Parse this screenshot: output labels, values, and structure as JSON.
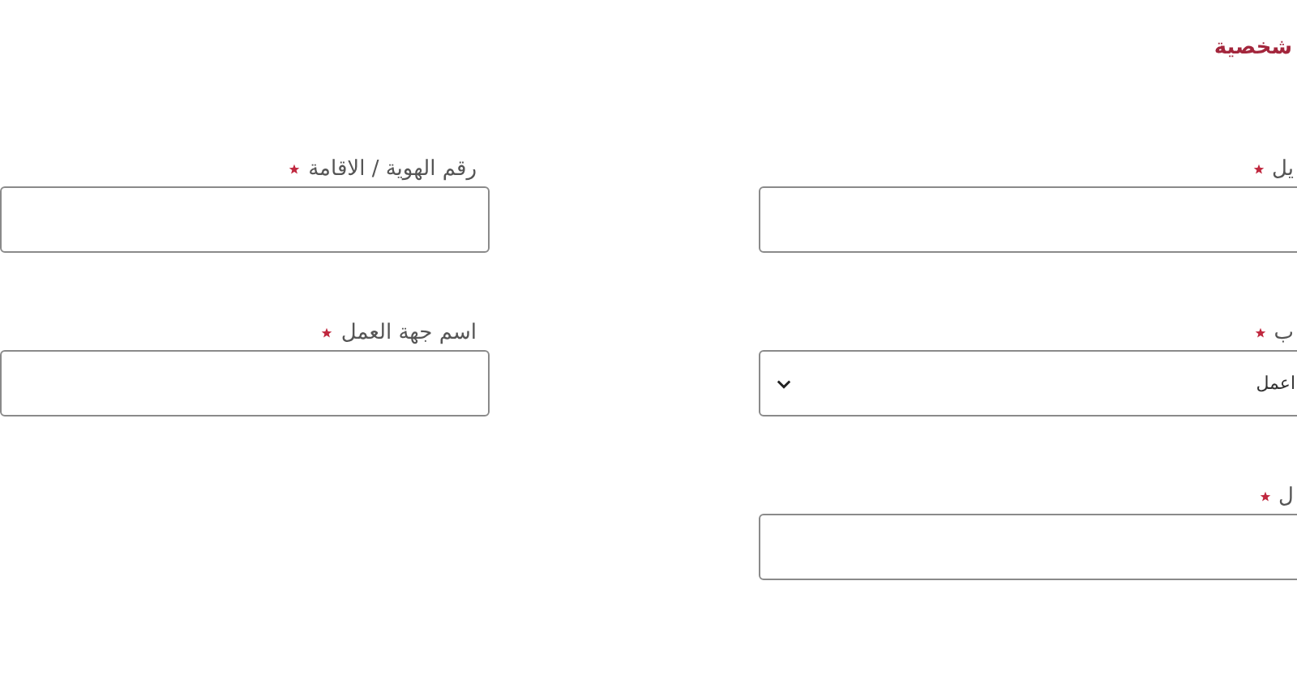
{
  "section_title": "شخصية",
  "fields": [
    {
      "label": "يل",
      "required": true,
      "kind": "input"
    },
    {
      "label": "رقم الهوية / الاقامة",
      "required": true,
      "kind": "input"
    },
    {
      "label": "ب",
      "required": true,
      "kind": "select",
      "value": "اعمل"
    },
    {
      "label": "اسم جهة العمل",
      "required": true,
      "kind": "input"
    },
    {
      "label": "ل",
      "required": true,
      "kind": "input"
    }
  ]
}
